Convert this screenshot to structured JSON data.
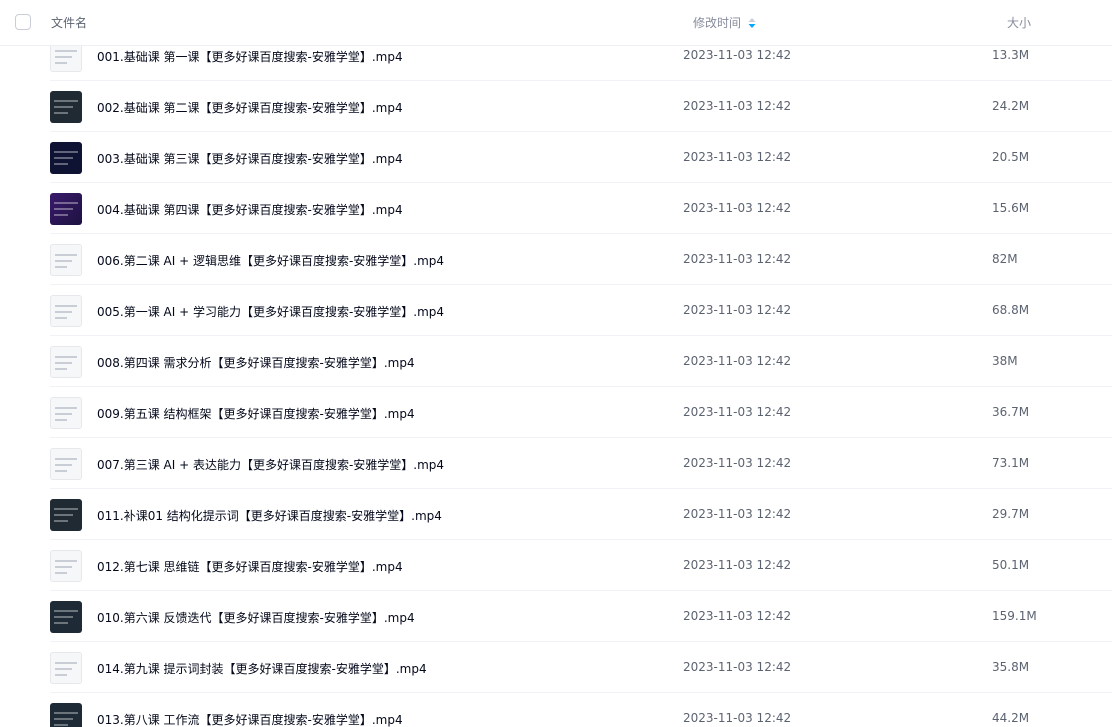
{
  "header": {
    "col_name": "文件名",
    "col_time": "修改时间",
    "col_size": "大小"
  },
  "files": [
    {
      "name": "001.基础课 第一课【更多好课百度搜索-安雅学堂】.mp4",
      "time": "2023-11-03 12:42",
      "size": "13.3M",
      "thumb": "light"
    },
    {
      "name": "002.基础课 第二课【更多好课百度搜索-安雅学堂】.mp4",
      "time": "2023-11-03 12:42",
      "size": "24.2M",
      "thumb": "dark"
    },
    {
      "name": "003.基础课 第三课【更多好课百度搜索-安雅学堂】.mp4",
      "time": "2023-11-03 12:42",
      "size": "20.5M",
      "thumb": "navy"
    },
    {
      "name": "004.基础课 第四课【更多好课百度搜索-安雅学堂】.mp4",
      "time": "2023-11-03 12:42",
      "size": "15.6M",
      "thumb": "purple"
    },
    {
      "name": "006.第二课 AI + 逻辑思维【更多好课百度搜索-安雅学堂】.mp4",
      "time": "2023-11-03 12:42",
      "size": "82M",
      "thumb": "light"
    },
    {
      "name": "005.第一课 AI + 学习能力【更多好课百度搜索-安雅学堂】.mp4",
      "time": "2023-11-03 12:42",
      "size": "68.8M",
      "thumb": "light"
    },
    {
      "name": "008.第四课 需求分析【更多好课百度搜索-安雅学堂】.mp4",
      "time": "2023-11-03 12:42",
      "size": "38M",
      "thumb": "light"
    },
    {
      "name": "009.第五课 结构框架【更多好课百度搜索-安雅学堂】.mp4",
      "time": "2023-11-03 12:42",
      "size": "36.7M",
      "thumb": "light"
    },
    {
      "name": "007.第三课 AI + 表达能力【更多好课百度搜索-安雅学堂】.mp4",
      "time": "2023-11-03 12:42",
      "size": "73.1M",
      "thumb": "light"
    },
    {
      "name": "011.补课01 结构化提示词【更多好课百度搜索-安雅学堂】.mp4",
      "time": "2023-11-03 12:42",
      "size": "29.7M",
      "thumb": "dark"
    },
    {
      "name": "012.第七课 思维链【更多好课百度搜索-安雅学堂】.mp4",
      "time": "2023-11-03 12:42",
      "size": "50.1M",
      "thumb": "light"
    },
    {
      "name": "010.第六课 反馈迭代【更多好课百度搜索-安雅学堂】.mp4",
      "time": "2023-11-03 12:42",
      "size": "159.1M",
      "thumb": "teal"
    },
    {
      "name": "014.第九课 提示词封装【更多好课百度搜索-安雅学堂】.mp4",
      "time": "2023-11-03 12:42",
      "size": "35.8M",
      "thumb": "light"
    },
    {
      "name": "013.第八课 工作流【更多好课百度搜索-安雅学堂】.mp4",
      "time": "2023-11-03 12:42",
      "size": "44.2M",
      "thumb": "teal"
    }
  ],
  "colors": {
    "sort_icon_top": "#c9ced6",
    "sort_icon_bottom": "#06a7ff"
  }
}
